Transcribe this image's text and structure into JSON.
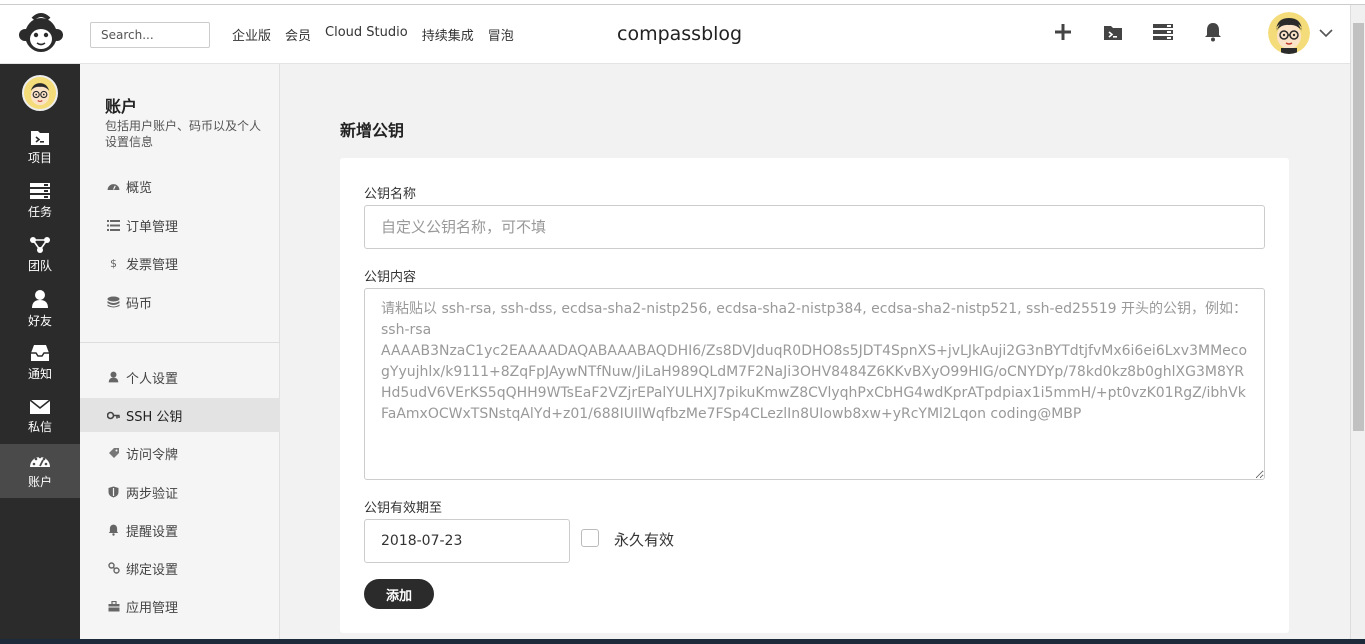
{
  "header": {
    "search_placeholder": "Search...",
    "nav": [
      "企业版",
      "会员",
      "Cloud Studio",
      "持续集成",
      "冒泡"
    ],
    "project_title": "compassblog"
  },
  "leftbar": {
    "items": [
      {
        "label": "项目",
        "icon": "folder-terminal-icon"
      },
      {
        "label": "任务",
        "icon": "tasks-icon"
      },
      {
        "label": "团队",
        "icon": "team-icon"
      },
      {
        "label": "好友",
        "icon": "user-icon"
      },
      {
        "label": "通知",
        "icon": "inbox-icon"
      },
      {
        "label": "私信",
        "icon": "mail-icon"
      },
      {
        "label": "账户",
        "icon": "dashboard-icon",
        "active": true
      }
    ]
  },
  "sidepanel": {
    "title": "账户",
    "description": "包括用户账户、码币以及个人设置信息",
    "items_top": [
      {
        "label": "概览",
        "icon": "dashboard-icon"
      },
      {
        "label": "订单管理",
        "icon": "list-icon"
      },
      {
        "label": "发票管理",
        "icon": "dollar-icon"
      },
      {
        "label": "码币",
        "icon": "coins-icon"
      }
    ],
    "items_bottom": [
      {
        "label": "个人设置",
        "icon": "user-icon"
      },
      {
        "label": "SSH 公钥",
        "icon": "key-icon",
        "active": true
      },
      {
        "label": "访问令牌",
        "icon": "tag-icon"
      },
      {
        "label": "两步验证",
        "icon": "shield-icon"
      },
      {
        "label": "提醒设置",
        "icon": "bell-icon"
      },
      {
        "label": "绑定设置",
        "icon": "link-icon"
      },
      {
        "label": "应用管理",
        "icon": "briefcase-icon"
      }
    ]
  },
  "main": {
    "title": "新增公钥",
    "form": {
      "name_label": "公钥名称",
      "name_placeholder": "自定义公钥名称，可不填",
      "content_label": "公钥内容",
      "content_placeholder": "请粘贴以 ssh-rsa, ssh-dss, ecdsa-sha2-nistp256, ecdsa-sha2-nistp384, ecdsa-sha2-nistp521, ssh-ed25519 开头的公钥，例如：ssh-rsa AAAAB3NzaC1yc2EAAAADAQABAAABAQDHI6/Zs8DVJduqR0DHO8s5JDT4SpnXS+jvLJkAuji2G3nBYTdtjfvMx6i6ei6Lxv3MMecogYyujhlx/k9111+8ZqFpJAywNTfNuw/JiLaH989QLdM7F2NaJi3OHV8484Z6KKvBXyO99HIG/oCNYDYp/78kd0kz8b0ghlXG3M8YRHd5udV6VErKS5qQHH9WTsEaF2VZjrEPalYULHXJ7pikuKmwZ8CVlyqhPxCbHG4wdKprATpdpiax1i5mmH/+pt0vzK01RgZ/ibhVkFaAmxOCWxTSNstqAlYd+z01/688IUIlWqfbzMe7FSp4CLezlIn8UIowb8xw+yRcYMl2Lqon coding@MBP",
      "expiry_label": "公钥有效期至",
      "expiry_value": "2018-07-23",
      "permanent_label": "永久有效",
      "permanent_checked": false,
      "submit_label": "添加"
    }
  }
}
